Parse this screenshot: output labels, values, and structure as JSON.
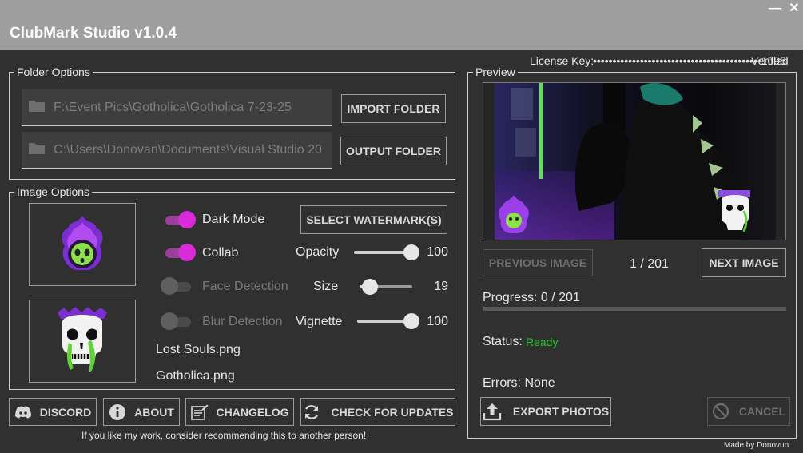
{
  "app": {
    "title": "ClubMark Studio v1.0.4",
    "minimize_glyph": "—",
    "close_glyph": "✕"
  },
  "license": {
    "label": "License Key:",
    "masked_key": "•••••••••••••••••••••••••••••••••••••••••••1095",
    "status": "Verified"
  },
  "folder_options": {
    "legend": "Folder Options",
    "import_path": "F:\\Event Pics\\Gotholica\\Gotholica 7-23-25",
    "output_path": "C:\\Users\\Donovan\\Documents\\Visual Studio 20",
    "import_button": "IMPORT FOLDER",
    "output_button": "OUTPUT FOLDER",
    "folder_icon": "folder-icon"
  },
  "image_options": {
    "legend": "Image Options",
    "toggles": {
      "dark_mode": {
        "label": "Dark Mode",
        "on": true
      },
      "collab": {
        "label": "Collab",
        "on": true
      },
      "face_detection": {
        "label": "Face Detection",
        "on": false
      },
      "blur_detection": {
        "label": "Blur Detection",
        "on": false
      }
    },
    "select_watermark_button": "SELECT WATERMARK(S)",
    "sliders": {
      "opacity": {
        "label": "Opacity",
        "value": "100",
        "fraction": 1.0
      },
      "size": {
        "label": "Size",
        "value": "19",
        "fraction": 0.19
      },
      "vignette": {
        "label": "Vignette",
        "value": "100",
        "fraction": 1.0
      }
    },
    "watermark_files": [
      "Lost Souls.png",
      "Gotholica.png"
    ]
  },
  "bottom_buttons": {
    "discord": {
      "label": "DISCORD",
      "icon": "discord-icon"
    },
    "about": {
      "label": "ABOUT",
      "icon": "info-icon"
    },
    "changelog": {
      "label": "CHANGELOG",
      "icon": "changelog-icon"
    },
    "check_updates": {
      "label": "CHECK FOR UPDATES",
      "icon": "refresh-icon"
    }
  },
  "footer_note": "If you like my work, consider recommending this to another person!",
  "preview": {
    "legend": "Preview",
    "prev_button": "PREVIOUS IMAGE",
    "next_button": "NEXT IMAGE",
    "counter": "1 / 201",
    "progress_label": "Progress: 0 / 201",
    "progress_fraction": 0.0,
    "status_label": "Status:",
    "status_value": "Ready",
    "errors_label": "Errors: None",
    "export_button": {
      "label": "EXPORT PHOTOS",
      "icon": "upload-icon"
    },
    "cancel_button": {
      "label": "CANCEL",
      "icon": "cancel-icon"
    }
  },
  "credit": "Made by Donovun",
  "colors": {
    "background": "#303030",
    "titlebar": "#9e9e9e",
    "accent_magenta": "#d92bd9",
    "status_ready": "#28c428"
  }
}
